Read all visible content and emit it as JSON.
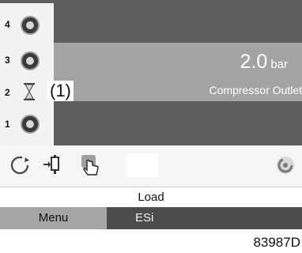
{
  "compressor_list": [
    {
      "position": "4",
      "icon": "fan-icon"
    },
    {
      "position": "3",
      "icon": "fan-icon"
    },
    {
      "position": "2",
      "icon": "hourglass-icon"
    },
    {
      "position": "1",
      "icon": "fan-icon"
    }
  ],
  "callout": "(1)",
  "reading": {
    "value": "2.0",
    "unit": "bar",
    "label": "Compressor Outlet"
  },
  "toolbar": {
    "icons": [
      "rotation-icon",
      "compressor-select-icon",
      "hand-touch-icon",
      "spinner-icon"
    ]
  },
  "status_text": "Load",
  "softkeys": {
    "menu": "Menu",
    "esi": "ESi"
  },
  "reference_code": "83987D"
}
